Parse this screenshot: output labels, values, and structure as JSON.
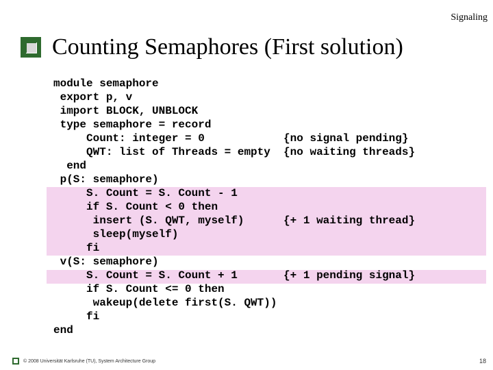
{
  "header": {
    "topic": "Signaling"
  },
  "title": "Counting Semaphores (First solution)",
  "code": {
    "lines": [
      "module semaphore",
      " export p, v",
      " import BLOCK, UNBLOCK",
      " type semaphore = record",
      "     Count: integer = 0            {no signal pending}",
      "     QWT: list of Threads = empty  {no waiting threads}",
      "  end",
      " p(S: semaphore)",
      "     S. Count = S. Count - 1",
      "     if S. Count < 0 then",
      "      insert (S. QWT, myself)      {+ 1 waiting thread}",
      "      sleep(myself)",
      "     fi",
      " v(S: semaphore)",
      "     S. Count = S. Count + 1       {+ 1 pending signal}",
      "     if S. Count <= 0 then",
      "      wakeup(delete first(S. QWT))",
      "     fi",
      "end"
    ]
  },
  "footer": {
    "copyright": "© 2008 Universität Karlsruhe (TU), System Architecture Group",
    "page": "18"
  }
}
